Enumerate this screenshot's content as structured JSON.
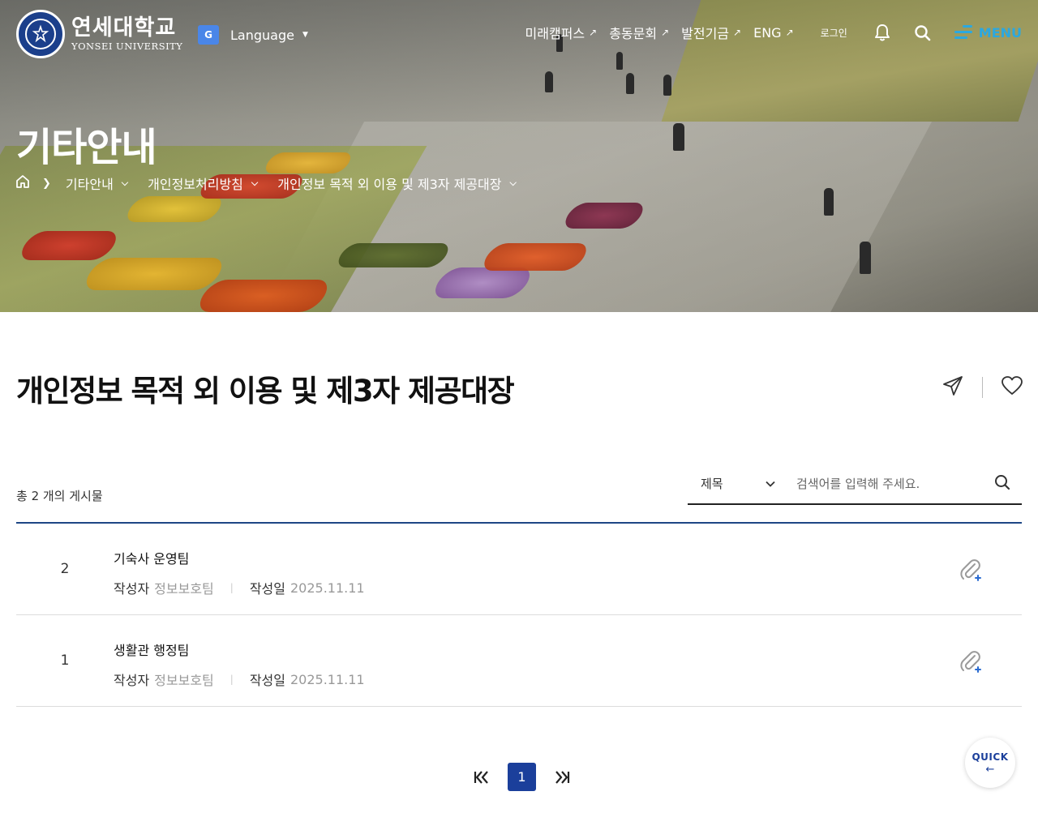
{
  "header": {
    "logo": {
      "korean": "연세대학교",
      "english": "YONSEI UNIVERSITY",
      "seal_text": "YONSEI UNIVERSITY"
    },
    "language": {
      "label": "Language",
      "icon": "google-translate-icon"
    },
    "nav_links": [
      {
        "label": "미래캠퍼스",
        "arrow": "↗"
      },
      {
        "label": "총동문회",
        "arrow": "↗"
      },
      {
        "label": "발전기금",
        "arrow": "↗"
      },
      {
        "label": "ENG",
        "arrow": "↗"
      }
    ],
    "login_label": "로그인",
    "menu_label": "MENU",
    "accent_color": "#2ba8e0"
  },
  "hero": {
    "title": "기타안내",
    "breadcrumb": [
      {
        "label": "기타안내"
      },
      {
        "label": "개인정보처리방침"
      },
      {
        "label": "개인정보 목적 외 이용 및 제3자 제공대장"
      }
    ]
  },
  "main": {
    "page_title": "개인정보 목적 외 이용 및 제3자 제공대장",
    "count_text": "총 2 개의 게시물",
    "search": {
      "select_value": "제목",
      "placeholder": "검색어를 입력해 주세요."
    },
    "posts": [
      {
        "number": "2",
        "title": "기숙사 운영팀",
        "author_label": "작성자",
        "author": "정보보호팀",
        "date_label": "작성일",
        "date": "2025.11.11",
        "has_attachment": true
      },
      {
        "number": "1",
        "title": "생활관 행정팀",
        "author_label": "작성자",
        "author": "정보보호팀",
        "date_label": "작성일",
        "date": "2025.11.11",
        "has_attachment": true
      }
    ],
    "pagination": {
      "current_page": "1"
    }
  },
  "quick": {
    "label": "QUICK",
    "arrow": "←"
  },
  "colors": {
    "primary_blue": "#1b3f9b",
    "list_border": "#1e4785"
  }
}
